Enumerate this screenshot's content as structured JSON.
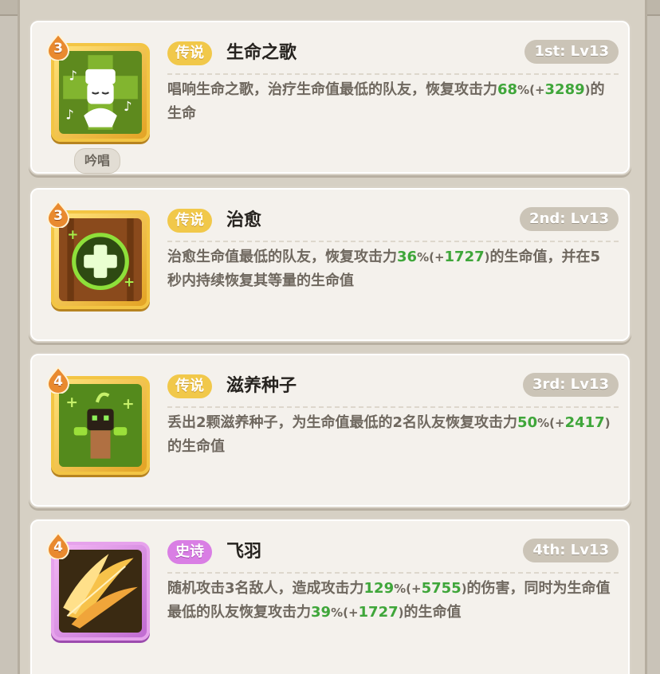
{
  "skills": [
    {
      "level_badge": "3",
      "rarity": "传说",
      "name": "生命之歌",
      "rank": "1st: Lv13",
      "sub_tag": "吟唱",
      "desc": {
        "p1": "唱响生命之歌，治疗生命值最低的队友，恢复攻击力",
        "v1": "68",
        "pct1": "%",
        "open1": "(+",
        "v2": "3289",
        "close1": ")",
        "p2": "的生命"
      }
    },
    {
      "level_badge": "3",
      "rarity": "传说",
      "name": "治愈",
      "rank": "2nd: Lv13",
      "desc": {
        "p1": "治愈生命值最低的队友，恢复攻击力",
        "v1": "36",
        "pct1": "%",
        "open1": "(+",
        "v2": "1727",
        "close1": ")",
        "p2": "的生命值，并在5秒内持续恢复其等量的生命值"
      }
    },
    {
      "level_badge": "4",
      "rarity": "传说",
      "name": "滋养种子",
      "rank": "3rd: Lv13",
      "desc": {
        "p1": "丢出2颗滋养种子，为生命值最低的2名队友恢复攻击力",
        "v1": "50",
        "pct1": "%",
        "open1": "(+",
        "v2": "2417",
        "close1": ")",
        "p2": "的生命值"
      }
    },
    {
      "level_badge": "4",
      "rarity": "史诗",
      "name": "飞羽",
      "rank": "4th: Lv13",
      "desc": {
        "p1": "随机攻击3名敌人，造成攻击力",
        "v1": "129",
        "pct1": "%",
        "open1": "(+",
        "v2": "5755",
        "close1": ")",
        "p2": "的伤害，同时为生命值最低的队友恢复攻击力",
        "v3": "39",
        "pct2": "%",
        "open2": "(+",
        "v4": "1727",
        "close2": ")",
        "p3": "的生命值"
      }
    }
  ],
  "icons": [
    "singing-cookie-icon",
    "healing-cross-icon",
    "seed-sprout-icon",
    "golden-feather-icon"
  ],
  "colors": {
    "legend": "#f1c84a",
    "epic": "#d97ee4",
    "value_green": "#3fa63a",
    "badge_orange": "#e98a2f"
  }
}
